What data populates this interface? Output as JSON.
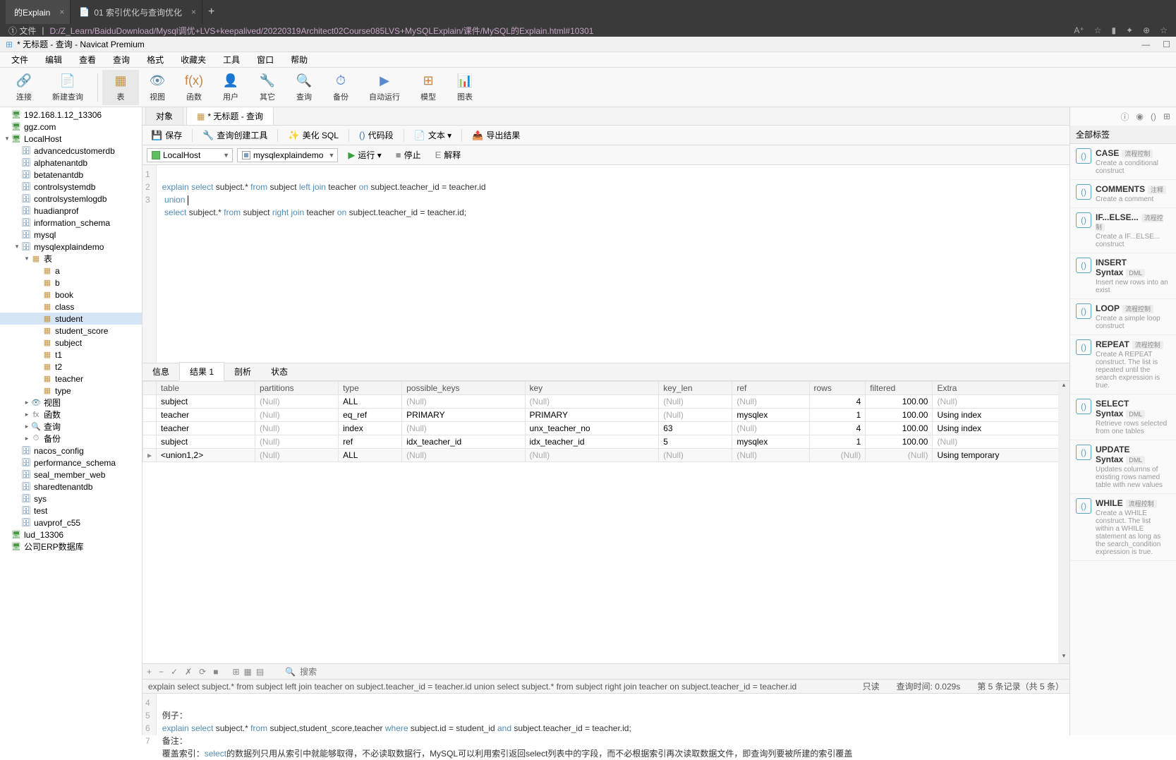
{
  "browser": {
    "tabs": [
      {
        "label": "的Explain",
        "active": true
      },
      {
        "label": "01 索引优化与查询优化",
        "active": false
      }
    ],
    "addr_label": "① 文件",
    "url": "D:/Z_Learn/BaiduDownload/Mysql调优+LVS+keepalived/20220319Architect02Course085LVS+MySQLExplain/课件/MySQL的Explain.html#10301"
  },
  "window": {
    "title": "* 无标题 - 查询 - Navicat Premium"
  },
  "menu": [
    "文件",
    "编辑",
    "查看",
    "查询",
    "格式",
    "收藏夹",
    "工具",
    "窗口",
    "帮助"
  ],
  "toolbar": [
    {
      "label": "连接",
      "icon": "🔗",
      "color": "#5a8ad0"
    },
    {
      "label": "新建查询",
      "icon": "📄",
      "color": "#5a8ad0"
    },
    {
      "label": "表",
      "icon": "▦",
      "color": "#c59545",
      "active": true
    },
    {
      "label": "视图",
      "icon": "👁",
      "color": "#5a8aa5"
    },
    {
      "label": "函数",
      "icon": "f(x)",
      "color": "#c58545"
    },
    {
      "label": "用户",
      "icon": "👤",
      "color": "#5a8ad0"
    },
    {
      "label": "其它",
      "icon": "🔧",
      "color": "#888"
    },
    {
      "label": "查询",
      "icon": "🔍",
      "color": "#5a8ad0"
    },
    {
      "label": "备份",
      "icon": "⏱",
      "color": "#5a8ad0"
    },
    {
      "label": "自动运行",
      "icon": "▶",
      "color": "#5a8ad0"
    },
    {
      "label": "模型",
      "icon": "⊞",
      "color": "#c58545"
    },
    {
      "label": "图表",
      "icon": "📊",
      "color": "#5a8ad0"
    }
  ],
  "sidebar": [
    {
      "txt": "192.168.1.12_13306",
      "ic": "🖥",
      "cls": "ic-conn",
      "depth": 0
    },
    {
      "txt": "ggz.com",
      "ic": "🖥",
      "cls": "ic-conn",
      "depth": 0
    },
    {
      "txt": "LocalHost",
      "ic": "🖥",
      "cls": "ic-conn",
      "depth": 0,
      "expand": "▾"
    },
    {
      "txt": "advancedcustomerdb",
      "ic": "🗄",
      "cls": "ic-db",
      "depth": 1
    },
    {
      "txt": "alphatenantdb",
      "ic": "🗄",
      "cls": "ic-db",
      "depth": 1
    },
    {
      "txt": "betatenantdb",
      "ic": "🗄",
      "cls": "ic-db",
      "depth": 1
    },
    {
      "txt": "controlsystemdb",
      "ic": "🗄",
      "cls": "ic-db",
      "depth": 1
    },
    {
      "txt": "controlsystemlogdb",
      "ic": "🗄",
      "cls": "ic-db",
      "depth": 1
    },
    {
      "txt": "huadianprof",
      "ic": "🗄",
      "cls": "ic-db",
      "depth": 1
    },
    {
      "txt": "information_schema",
      "ic": "🗄",
      "cls": "ic-db",
      "depth": 1
    },
    {
      "txt": "mysql",
      "ic": "🗄",
      "cls": "ic-db",
      "depth": 1
    },
    {
      "txt": "mysqlexplaindemo",
      "ic": "🗄",
      "cls": "ic-db",
      "depth": 1,
      "expand": "▾"
    },
    {
      "txt": "表",
      "ic": "▦",
      "cls": "ic-table",
      "depth": 2,
      "expand": "▾"
    },
    {
      "txt": "a",
      "ic": "▦",
      "cls": "ic-table",
      "depth": 3
    },
    {
      "txt": "b",
      "ic": "▦",
      "cls": "ic-table",
      "depth": 3
    },
    {
      "txt": "book",
      "ic": "▦",
      "cls": "ic-table",
      "depth": 3
    },
    {
      "txt": "class",
      "ic": "▦",
      "cls": "ic-table",
      "depth": 3
    },
    {
      "txt": "student",
      "ic": "▦",
      "cls": "ic-table",
      "depth": 3,
      "sel": true
    },
    {
      "txt": "student_score",
      "ic": "▦",
      "cls": "ic-table",
      "depth": 3
    },
    {
      "txt": "subject",
      "ic": "▦",
      "cls": "ic-table",
      "depth": 3
    },
    {
      "txt": "t1",
      "ic": "▦",
      "cls": "ic-table",
      "depth": 3
    },
    {
      "txt": "t2",
      "ic": "▦",
      "cls": "ic-table",
      "depth": 3
    },
    {
      "txt": "teacher",
      "ic": "▦",
      "cls": "ic-table",
      "depth": 3
    },
    {
      "txt": "type",
      "ic": "▦",
      "cls": "ic-table",
      "depth": 3
    },
    {
      "txt": "视图",
      "ic": "👁",
      "cls": "ic-view",
      "depth": 2,
      "expand": "▸"
    },
    {
      "txt": "函数",
      "ic": "fx",
      "cls": "ic-folder",
      "depth": 2,
      "expand": "▸"
    },
    {
      "txt": "查询",
      "ic": "🔍",
      "cls": "ic-folder",
      "depth": 2,
      "expand": "▸"
    },
    {
      "txt": "备份",
      "ic": "⏱",
      "cls": "ic-folder",
      "depth": 2,
      "expand": "▸"
    },
    {
      "txt": "nacos_config",
      "ic": "🗄",
      "cls": "ic-db",
      "depth": 1
    },
    {
      "txt": "performance_schema",
      "ic": "🗄",
      "cls": "ic-db",
      "depth": 1
    },
    {
      "txt": "seal_member_web",
      "ic": "🗄",
      "cls": "ic-db",
      "depth": 1
    },
    {
      "txt": "sharedtenantdb",
      "ic": "🗄",
      "cls": "ic-db",
      "depth": 1
    },
    {
      "txt": "sys",
      "ic": "🗄",
      "cls": "ic-db",
      "depth": 1
    },
    {
      "txt": "test",
      "ic": "🗄",
      "cls": "ic-db",
      "depth": 1
    },
    {
      "txt": "uavprof_c55",
      "ic": "🗄",
      "cls": "ic-db",
      "depth": 1
    },
    {
      "txt": "lud_13306",
      "ic": "🖥",
      "cls": "ic-conn",
      "depth": 0
    },
    {
      "txt": "公司ERP数据库",
      "ic": "🖥",
      "cls": "ic-conn",
      "depth": 0
    }
  ],
  "doc_tabs": [
    {
      "label": "对象",
      "active": false
    },
    {
      "label": "* 无标题 - 查询",
      "active": true
    }
  ],
  "editor_tb": [
    {
      "ic": "💾",
      "label": "保存"
    },
    {
      "ic": "🔧",
      "label": "查询创建工具"
    },
    {
      "ic": "✨",
      "label": "美化 SQL"
    },
    {
      "ic": "()",
      "label": "代码段",
      "color": "#3a7ab5"
    },
    {
      "ic": "📄",
      "label": "文本 ▾"
    },
    {
      "ic": "📤",
      "label": "导出结果"
    }
  ],
  "combo_conn": "LocalHost",
  "combo_db": "mysqlexplaindemo",
  "run_items": [
    {
      "ic": "▶",
      "label": "运行 ▾",
      "color": "#3aa03a"
    },
    {
      "ic": "■",
      "label": "停止",
      "color": "#999"
    },
    {
      "ic": "E",
      "label": "解释",
      "color": "#888"
    }
  ],
  "code_lines": [
    1,
    2,
    3
  ],
  "sql": {
    "l1a": "explain",
    "l1b": "select",
    "l1c": "subject",
    "l1d": ".*",
    "l1e": "from",
    "l1f": "subject",
    "l1g": "left",
    "l1h": "join",
    "l1i": "teacher",
    "l1j": "on",
    "l1k": "subject",
    "l1l": ".teacher_id = ",
    "l1m": "teacher",
    "l1n": ".id",
    "l2a": " union",
    "l3a": " select",
    "l3b": "subject",
    "l3c": ".*",
    "l3d": "from",
    "l3e": "subject",
    "l3f": "right",
    "l3g": "join",
    "l3h": "teacher",
    "l3i": "on",
    "l3j": "subject",
    "l3k": ".teacher_id = ",
    "l3l": "teacher",
    "l3m": ".id;"
  },
  "result_tabs": [
    "信息",
    "结果 1",
    "剖析",
    "状态"
  ],
  "result_tab_active": 1,
  "grid_headers": [
    "",
    "table",
    "partitions",
    "type",
    "possible_keys",
    "key",
    "key_len",
    "ref",
    "rows",
    "filtered",
    "Extra"
  ],
  "grid_rows": [
    {
      "mark": "",
      "cells": [
        "subject",
        "(Null)",
        "ALL",
        "(Null)",
        "(Null)",
        "(Null)",
        "(Null)",
        "4",
        "100.00",
        "(Null)"
      ]
    },
    {
      "mark": "",
      "cells": [
        "teacher",
        "(Null)",
        "eq_ref",
        "PRIMARY",
        "PRIMARY",
        "(Null)",
        "mysqlex",
        "1",
        "100.00",
        "Using index"
      ]
    },
    {
      "mark": "",
      "cells": [
        "teacher",
        "(Null)",
        "index",
        "(Null)",
        "unx_teacher_no",
        "63",
        "(Null)",
        "4",
        "100.00",
        "Using index"
      ]
    },
    {
      "mark": "",
      "cells": [
        "subject",
        "(Null)",
        "ref",
        "idx_teacher_id",
        "idx_teacher_id",
        "5",
        "mysqlex",
        "1",
        "100.00",
        "(Null)"
      ]
    },
    {
      "mark": "▸",
      "cells": [
        "<union1,2>",
        "(Null)",
        "ALL",
        "(Null)",
        "(Null)",
        "(Null)",
        "(Null)",
        "(Null)",
        "(Null)",
        "Using temporary"
      ],
      "sel": true
    }
  ],
  "grid_footer_icons": [
    "+",
    "−",
    "✓",
    "✗",
    "⟳",
    "■"
  ],
  "grid_footer_right": [
    "⊞",
    "▦",
    "▤"
  ],
  "search_placeholder": "搜索",
  "status": {
    "sql": "explain select subject.* from subject left join teacher on subject.teacher_id = teacher.id   union   select subject.* from subject right join teacher on subject.teacher_id = teacher.id",
    "readonly": "只读",
    "time": "查询时间: 0.029s",
    "records": "第 5 条记录（共 5 条）"
  },
  "lower_lines": [
    4,
    5,
    6,
    7
  ],
  "lower": {
    "l4": "例子：",
    "l5a": "explain",
    "l5b": "select",
    "l5c": " subject.* ",
    "l5d": "from",
    "l5e": " subject,student_score,teacher ",
    "l5f": "where",
    "l5g": " subject.id = student_id ",
    "l5h": "and",
    "l5i": " subject.teacher_id = teacher.id;",
    "l6": "备注：",
    "l7a": "覆盖索引：",
    "l7b": "select",
    "l7c": "的数据列只用从索引中就能够取得，不必读取数据行，MySQL可以利用索引返回select列表中的字段，而不必根据索引再次读取数据文件，即查询列要被所建的索引覆盖"
  },
  "right_panel": {
    "header": "全部标签",
    "icons": [
      "ⓘ",
      "◉",
      "()",
      "⊞"
    ],
    "items": [
      {
        "title": "CASE",
        "badge": "流程控制",
        "desc": "Create a conditional construct"
      },
      {
        "title": "COMMENTS",
        "badge": "注释",
        "desc": "Create a comment"
      },
      {
        "title": "IF...ELSE...",
        "badge": "流程控制",
        "desc": "Create a IF...ELSE... construct"
      },
      {
        "title": "INSERT Syntax",
        "badge": "DML",
        "desc": "Insert new rows into an exist"
      },
      {
        "title": "LOOP",
        "badge": "流程控制",
        "desc": "Create a simple loop construct"
      },
      {
        "title": "REPEAT",
        "badge": "流程控制",
        "desc": "Create A REPEAT construct. The list is repeated until the search expression is true."
      },
      {
        "title": "SELECT Syntax",
        "badge": "DML",
        "desc": "Retrieve rows selected from one tables"
      },
      {
        "title": "UPDATE Syntax",
        "badge": "DML",
        "desc": "Updates columns of existing rows named table with new values"
      },
      {
        "title": "WHILE",
        "badge": "流程控制",
        "desc": "Create a WHILE construct. The list within a WHILE statement as long as the search_condition expression is true."
      }
    ]
  }
}
